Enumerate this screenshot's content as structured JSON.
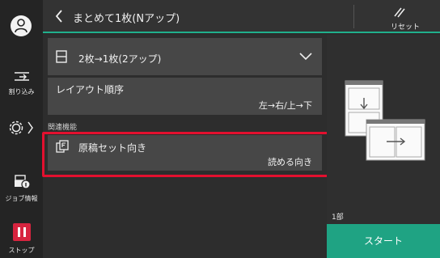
{
  "sidebar": {
    "interrupt_label": "割り込み",
    "job_info_label": "ジョブ情報",
    "stop_label": "ストップ"
  },
  "header": {
    "title": "まとめて1枚(Nアップ)",
    "reset_label": "リセット"
  },
  "main": {
    "nup_select": {
      "value": "2枚→1枚(2アップ)",
      "icon": "single-page-icon"
    },
    "layout_order": {
      "label": "レイアウト順序",
      "value": "左→右/上→下"
    },
    "related_section_label": "関連機能",
    "orientation": {
      "label": "原稿セット向き",
      "value": "読める向き",
      "icon": "document-orientation-icon"
    }
  },
  "preview": {
    "copies_label": "1部"
  },
  "start_button": {
    "label": "スタート"
  },
  "colors": {
    "accent": "#1fa383",
    "highlight": "#e3102f",
    "stop": "#d7243f"
  }
}
